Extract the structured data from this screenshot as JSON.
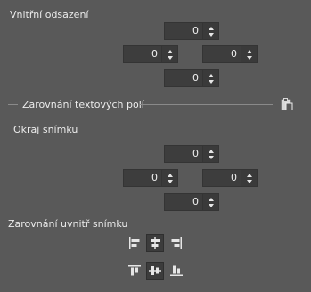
{
  "padding": {
    "title": "Vnitřní odsazení",
    "top": "0",
    "left": "0",
    "right": "0",
    "bottom": "0"
  },
  "text_field_alignment": {
    "title": "Zarovnání textových polí",
    "paste_icon": "paste-icon"
  },
  "frame_margin": {
    "title": "Okraj snímku",
    "top": "0",
    "left": "0",
    "right": "0",
    "bottom": "0"
  },
  "frame_alignment": {
    "title": "Zarovnání uvnitř snímku",
    "horizontal": [
      {
        "icon": "align-left-icon",
        "active": false
      },
      {
        "icon": "align-center-horizontal-icon",
        "active": true
      },
      {
        "icon": "align-right-icon",
        "active": false
      }
    ],
    "vertical": [
      {
        "icon": "align-top-icon",
        "active": false
      },
      {
        "icon": "align-center-vertical-icon",
        "active": true
      },
      {
        "icon": "align-bottom-icon",
        "active": false
      }
    ]
  },
  "colors": {
    "panel_bg": "#595959",
    "field_bg": "#3d3d3d",
    "text": "#ececec"
  }
}
